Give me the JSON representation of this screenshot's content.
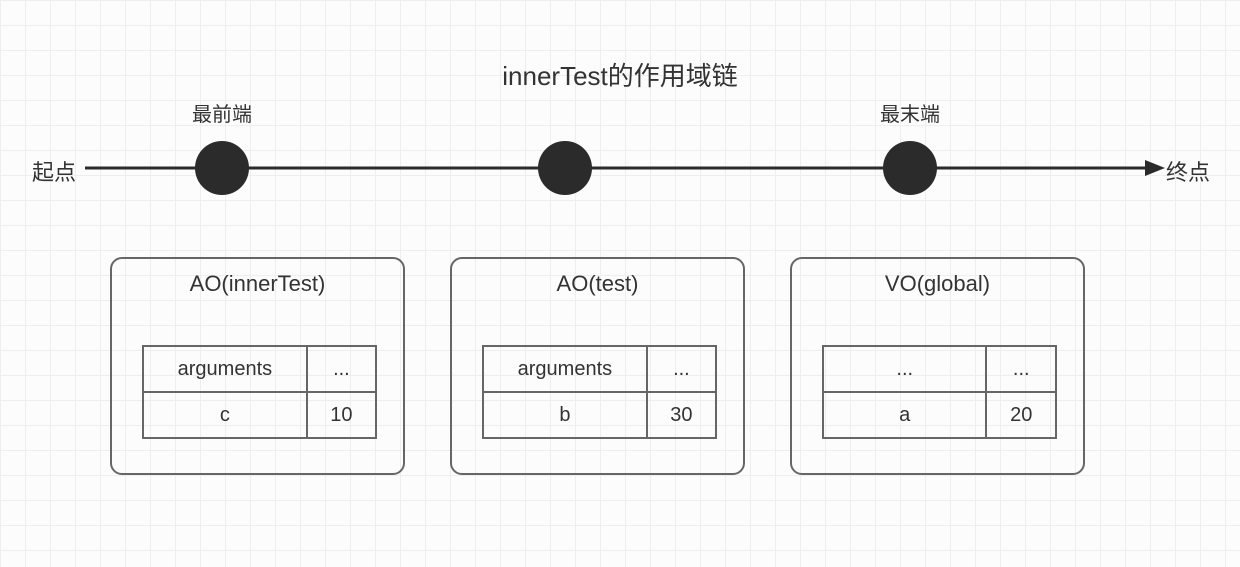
{
  "title": "innerTest的作用域链",
  "startLabel": "起点",
  "endLabel": "终点",
  "frontLabel": "最前端",
  "rearLabel": "最末端",
  "boxes": [
    {
      "title": "AO(innerTest)",
      "rows": [
        {
          "key": "arguments",
          "val": "..."
        },
        {
          "key": "c",
          "val": "10"
        }
      ]
    },
    {
      "title": "AO(test)",
      "rows": [
        {
          "key": "arguments",
          "val": "..."
        },
        {
          "key": "b",
          "val": "30"
        }
      ]
    },
    {
      "title": "VO(global)",
      "rows": [
        {
          "key": "...",
          "val": "..."
        },
        {
          "key": "a",
          "val": "20"
        }
      ]
    }
  ]
}
